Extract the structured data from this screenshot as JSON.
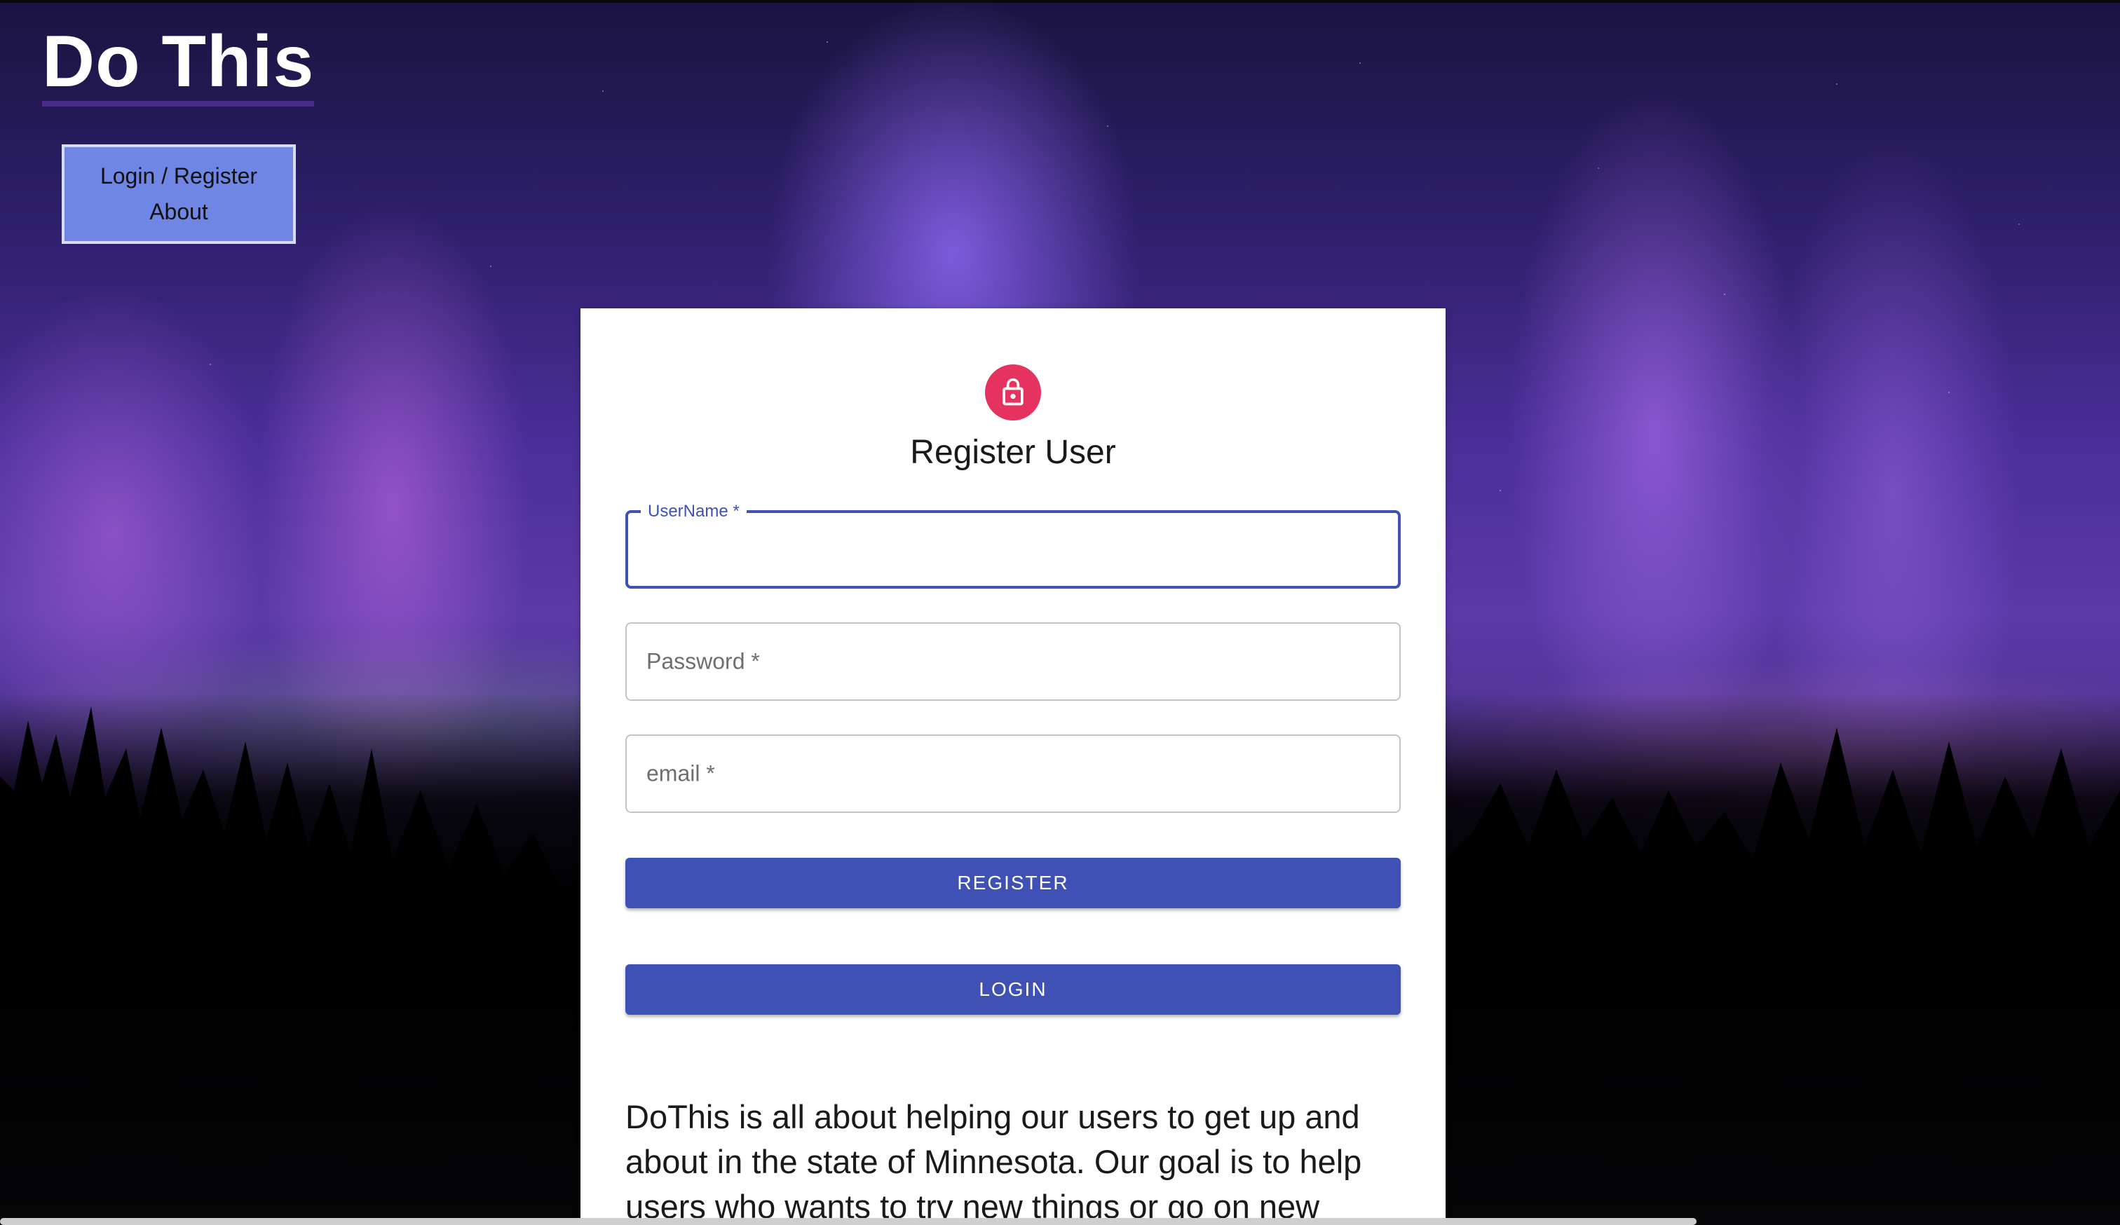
{
  "header": {
    "site_title": "Do This"
  },
  "nav": {
    "items": [
      {
        "label": "Login / Register"
      },
      {
        "label": "About"
      }
    ]
  },
  "form": {
    "title": "Register User",
    "icon": "lock-icon",
    "icon_color": "#e5325f",
    "fields": [
      {
        "label": "UserName *",
        "value": "",
        "focused": true
      },
      {
        "label": "Password *",
        "value": ""
      },
      {
        "label": "email *",
        "value": ""
      }
    ],
    "register_label": "REGISTER",
    "login_label": "LOGIN",
    "accent_color": "#3f51b5"
  },
  "about": {
    "text": "DoThis is all about helping our users to get up and about in the state of Minnesota. Our goal is to help users who wants to try new things or go on new"
  }
}
